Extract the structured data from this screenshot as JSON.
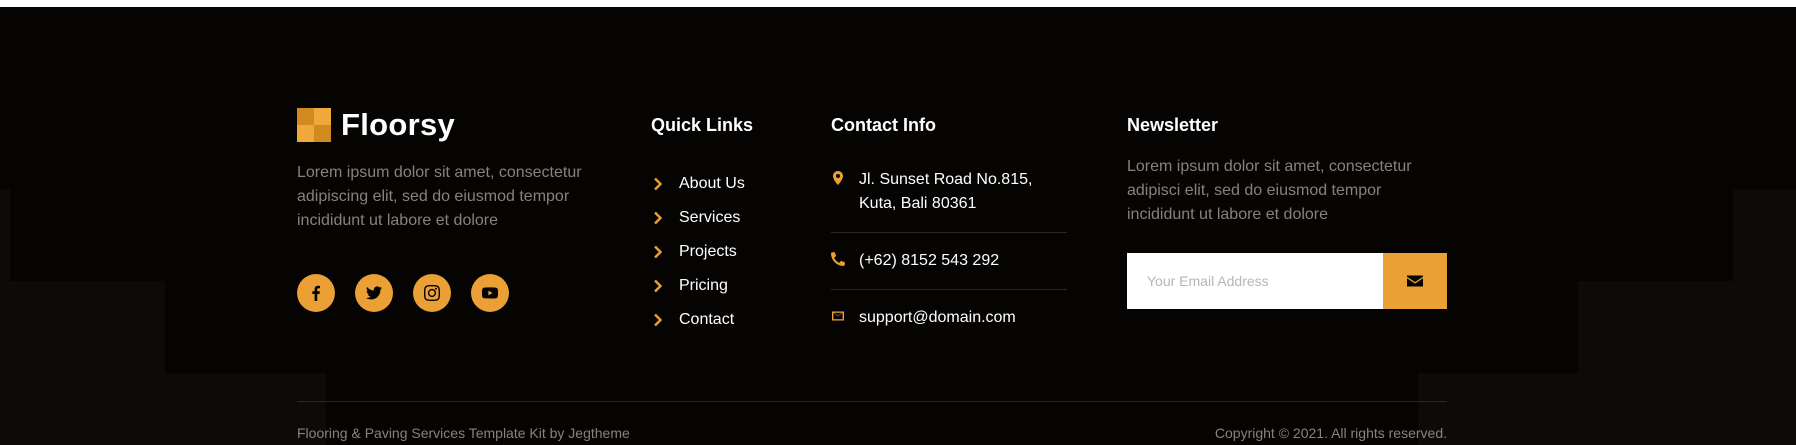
{
  "brand": {
    "name": "Floorsy",
    "description": "Lorem ipsum dolor sit amet, consectetur adipiscing elit, sed do eiusmod tempor incididunt ut labore et dolore"
  },
  "socials": [
    {
      "icon": "facebook-icon"
    },
    {
      "icon": "twitter-icon"
    },
    {
      "icon": "instagram-icon"
    },
    {
      "icon": "youtube-icon"
    }
  ],
  "quick_links": {
    "title": "Quick Links",
    "items": [
      {
        "label": "About Us"
      },
      {
        "label": "Services"
      },
      {
        "label": "Projects"
      },
      {
        "label": "Pricing"
      },
      {
        "label": "Contact"
      }
    ]
  },
  "contact": {
    "title": "Contact Info",
    "address": "Jl. Sunset Road No.815, Kuta, Bali 80361",
    "phone": "(+62) 8152 543 292",
    "email": "support@domain.com"
  },
  "newsletter": {
    "title": "Newsletter",
    "text": "Lorem ipsum dolor sit amet, consectetur adipisci elit, sed do eiusmod tempor incididunt ut labore et dolore",
    "placeholder": "Your Email Address"
  },
  "bottom": {
    "credit": "Flooring & Paving Services Template Kit by Jegtheme",
    "copyright": "Copyright © 2021. All rights reserved."
  },
  "colors": {
    "accent": "#eaa034",
    "background": "#050403",
    "muted_text": "#86837f"
  }
}
